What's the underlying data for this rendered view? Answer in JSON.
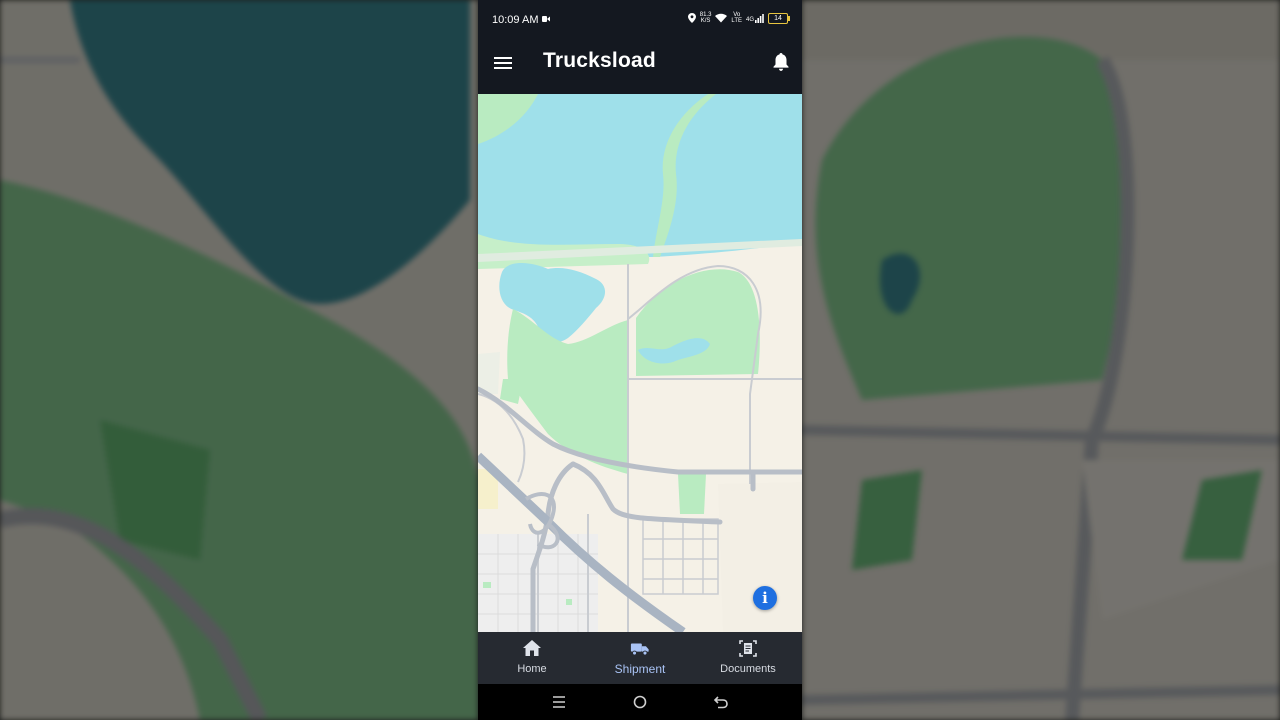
{
  "status_bar": {
    "time": "10:09 AM",
    "speed": "81.3",
    "speed_unit": "K/S",
    "volte_top": "Vo",
    "volte_bottom": "LTE",
    "network": "4G",
    "battery": "14"
  },
  "app_bar": {
    "title": "Trucksload",
    "menu_icon": "hamburger-menu-icon",
    "notification_icon": "bell-icon"
  },
  "map": {
    "info_button_label": "i",
    "colors": {
      "land": "#f5f1e7",
      "water": "#9fe0ea",
      "park": "#b9ebc1",
      "road": "#c9ccd1",
      "highway": "#a9b4c2"
    }
  },
  "bottom_nav": {
    "items": [
      {
        "label": "Home",
        "icon": "home-icon",
        "active": false
      },
      {
        "label": "Shipment",
        "icon": "truck-icon",
        "active": true
      },
      {
        "label": "Documents",
        "icon": "document-scan-icon",
        "active": false
      }
    ],
    "active_color": "#a9c3f5"
  },
  "system_nav": {
    "icons": [
      "recents-icon",
      "home-circle-icon",
      "back-icon"
    ]
  }
}
